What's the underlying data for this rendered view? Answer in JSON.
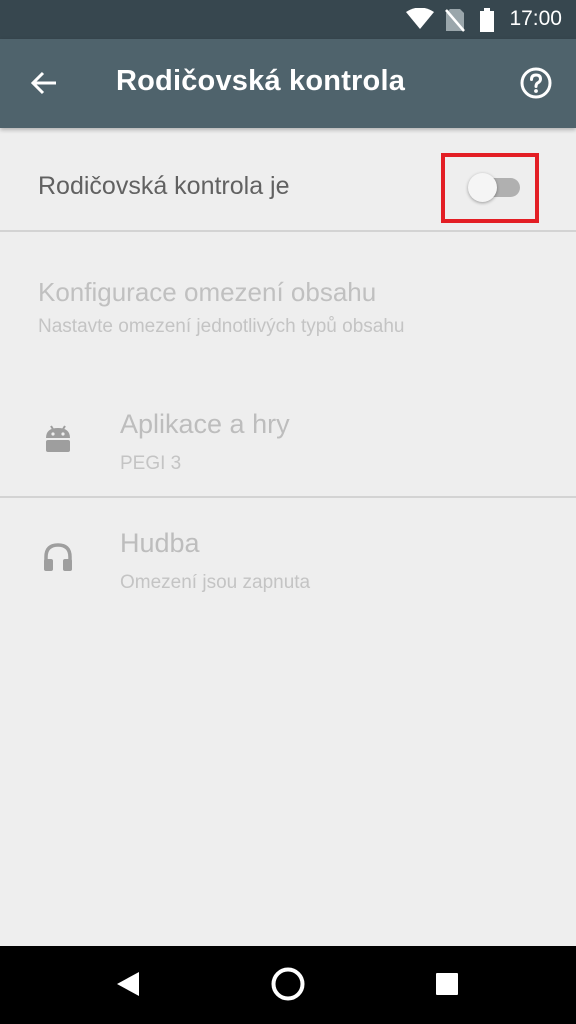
{
  "status_bar": {
    "time": "17:00",
    "icons": [
      "wifi-icon",
      "no-sim-icon",
      "battery-icon"
    ]
  },
  "app_bar": {
    "title": "Rodičovská kontrola",
    "back_icon": "arrow-back-icon",
    "help_icon": "help-circle-icon"
  },
  "toggle_row": {
    "label": "Rodičovská kontrola je",
    "switch_state": "off",
    "highlight_color": "#e31e24"
  },
  "content_restrictions": {
    "title": "Konfigurace omezení obsahu",
    "subtitle": "Nastavte omezení jednotlivých typů obsahu"
  },
  "items": [
    {
      "icon": "android-icon",
      "title": "Aplikace a hry",
      "subtitle": "PEGI 3"
    },
    {
      "icon": "headphones-icon",
      "title": "Hudba",
      "subtitle": "Omezení jsou zapnuta"
    }
  ],
  "nav_bar": {
    "buttons": [
      "back-triangle-icon",
      "home-circle-icon",
      "recents-square-icon"
    ]
  },
  "colors": {
    "status_bar": "#37474f",
    "app_bar": "#4f636c",
    "background": "#eeeeee",
    "disabled_text": "#bdbdbd"
  }
}
